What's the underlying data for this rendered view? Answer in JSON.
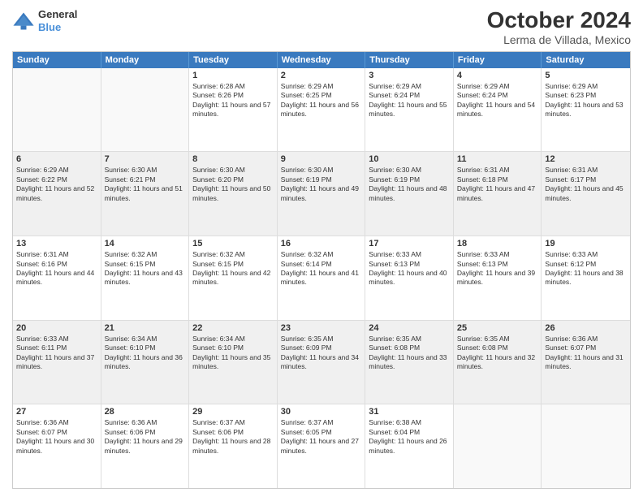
{
  "header": {
    "logo_line1": "General",
    "logo_line2": "Blue",
    "title": "October 2024",
    "subtitle": "Lerma de Villada, Mexico"
  },
  "weekdays": [
    "Sunday",
    "Monday",
    "Tuesday",
    "Wednesday",
    "Thursday",
    "Friday",
    "Saturday"
  ],
  "weeks": [
    [
      {
        "day": "",
        "sunrise": "",
        "sunset": "",
        "daylight": "",
        "empty": true
      },
      {
        "day": "",
        "sunrise": "",
        "sunset": "",
        "daylight": "",
        "empty": true
      },
      {
        "day": "1",
        "sunrise": "Sunrise: 6:28 AM",
        "sunset": "Sunset: 6:26 PM",
        "daylight": "Daylight: 11 hours and 57 minutes.",
        "empty": false
      },
      {
        "day": "2",
        "sunrise": "Sunrise: 6:29 AM",
        "sunset": "Sunset: 6:25 PM",
        "daylight": "Daylight: 11 hours and 56 minutes.",
        "empty": false
      },
      {
        "day": "3",
        "sunrise": "Sunrise: 6:29 AM",
        "sunset": "Sunset: 6:24 PM",
        "daylight": "Daylight: 11 hours and 55 minutes.",
        "empty": false
      },
      {
        "day": "4",
        "sunrise": "Sunrise: 6:29 AM",
        "sunset": "Sunset: 6:24 PM",
        "daylight": "Daylight: 11 hours and 54 minutes.",
        "empty": false
      },
      {
        "day": "5",
        "sunrise": "Sunrise: 6:29 AM",
        "sunset": "Sunset: 6:23 PM",
        "daylight": "Daylight: 11 hours and 53 minutes.",
        "empty": false
      }
    ],
    [
      {
        "day": "6",
        "sunrise": "Sunrise: 6:29 AM",
        "sunset": "Sunset: 6:22 PM",
        "daylight": "Daylight: 11 hours and 52 minutes.",
        "empty": false
      },
      {
        "day": "7",
        "sunrise": "Sunrise: 6:30 AM",
        "sunset": "Sunset: 6:21 PM",
        "daylight": "Daylight: 11 hours and 51 minutes.",
        "empty": false
      },
      {
        "day": "8",
        "sunrise": "Sunrise: 6:30 AM",
        "sunset": "Sunset: 6:20 PM",
        "daylight": "Daylight: 11 hours and 50 minutes.",
        "empty": false
      },
      {
        "day": "9",
        "sunrise": "Sunrise: 6:30 AM",
        "sunset": "Sunset: 6:19 PM",
        "daylight": "Daylight: 11 hours and 49 minutes.",
        "empty": false
      },
      {
        "day": "10",
        "sunrise": "Sunrise: 6:30 AM",
        "sunset": "Sunset: 6:19 PM",
        "daylight": "Daylight: 11 hours and 48 minutes.",
        "empty": false
      },
      {
        "day": "11",
        "sunrise": "Sunrise: 6:31 AM",
        "sunset": "Sunset: 6:18 PM",
        "daylight": "Daylight: 11 hours and 47 minutes.",
        "empty": false
      },
      {
        "day": "12",
        "sunrise": "Sunrise: 6:31 AM",
        "sunset": "Sunset: 6:17 PM",
        "daylight": "Daylight: 11 hours and 45 minutes.",
        "empty": false
      }
    ],
    [
      {
        "day": "13",
        "sunrise": "Sunrise: 6:31 AM",
        "sunset": "Sunset: 6:16 PM",
        "daylight": "Daylight: 11 hours and 44 minutes.",
        "empty": false
      },
      {
        "day": "14",
        "sunrise": "Sunrise: 6:32 AM",
        "sunset": "Sunset: 6:15 PM",
        "daylight": "Daylight: 11 hours and 43 minutes.",
        "empty": false
      },
      {
        "day": "15",
        "sunrise": "Sunrise: 6:32 AM",
        "sunset": "Sunset: 6:15 PM",
        "daylight": "Daylight: 11 hours and 42 minutes.",
        "empty": false
      },
      {
        "day": "16",
        "sunrise": "Sunrise: 6:32 AM",
        "sunset": "Sunset: 6:14 PM",
        "daylight": "Daylight: 11 hours and 41 minutes.",
        "empty": false
      },
      {
        "day": "17",
        "sunrise": "Sunrise: 6:33 AM",
        "sunset": "Sunset: 6:13 PM",
        "daylight": "Daylight: 11 hours and 40 minutes.",
        "empty": false
      },
      {
        "day": "18",
        "sunrise": "Sunrise: 6:33 AM",
        "sunset": "Sunset: 6:13 PM",
        "daylight": "Daylight: 11 hours and 39 minutes.",
        "empty": false
      },
      {
        "day": "19",
        "sunrise": "Sunrise: 6:33 AM",
        "sunset": "Sunset: 6:12 PM",
        "daylight": "Daylight: 11 hours and 38 minutes.",
        "empty": false
      }
    ],
    [
      {
        "day": "20",
        "sunrise": "Sunrise: 6:33 AM",
        "sunset": "Sunset: 6:11 PM",
        "daylight": "Daylight: 11 hours and 37 minutes.",
        "empty": false
      },
      {
        "day": "21",
        "sunrise": "Sunrise: 6:34 AM",
        "sunset": "Sunset: 6:10 PM",
        "daylight": "Daylight: 11 hours and 36 minutes.",
        "empty": false
      },
      {
        "day": "22",
        "sunrise": "Sunrise: 6:34 AM",
        "sunset": "Sunset: 6:10 PM",
        "daylight": "Daylight: 11 hours and 35 minutes.",
        "empty": false
      },
      {
        "day": "23",
        "sunrise": "Sunrise: 6:35 AM",
        "sunset": "Sunset: 6:09 PM",
        "daylight": "Daylight: 11 hours and 34 minutes.",
        "empty": false
      },
      {
        "day": "24",
        "sunrise": "Sunrise: 6:35 AM",
        "sunset": "Sunset: 6:08 PM",
        "daylight": "Daylight: 11 hours and 33 minutes.",
        "empty": false
      },
      {
        "day": "25",
        "sunrise": "Sunrise: 6:35 AM",
        "sunset": "Sunset: 6:08 PM",
        "daylight": "Daylight: 11 hours and 32 minutes.",
        "empty": false
      },
      {
        "day": "26",
        "sunrise": "Sunrise: 6:36 AM",
        "sunset": "Sunset: 6:07 PM",
        "daylight": "Daylight: 11 hours and 31 minutes.",
        "empty": false
      }
    ],
    [
      {
        "day": "27",
        "sunrise": "Sunrise: 6:36 AM",
        "sunset": "Sunset: 6:07 PM",
        "daylight": "Daylight: 11 hours and 30 minutes.",
        "empty": false
      },
      {
        "day": "28",
        "sunrise": "Sunrise: 6:36 AM",
        "sunset": "Sunset: 6:06 PM",
        "daylight": "Daylight: 11 hours and 29 minutes.",
        "empty": false
      },
      {
        "day": "29",
        "sunrise": "Sunrise: 6:37 AM",
        "sunset": "Sunset: 6:06 PM",
        "daylight": "Daylight: 11 hours and 28 minutes.",
        "empty": false
      },
      {
        "day": "30",
        "sunrise": "Sunrise: 6:37 AM",
        "sunset": "Sunset: 6:05 PM",
        "daylight": "Daylight: 11 hours and 27 minutes.",
        "empty": false
      },
      {
        "day": "31",
        "sunrise": "Sunrise: 6:38 AM",
        "sunset": "Sunset: 6:04 PM",
        "daylight": "Daylight: 11 hours and 26 minutes.",
        "empty": false
      },
      {
        "day": "",
        "sunrise": "",
        "sunset": "",
        "daylight": "",
        "empty": true
      },
      {
        "day": "",
        "sunrise": "",
        "sunset": "",
        "daylight": "",
        "empty": true
      }
    ]
  ]
}
